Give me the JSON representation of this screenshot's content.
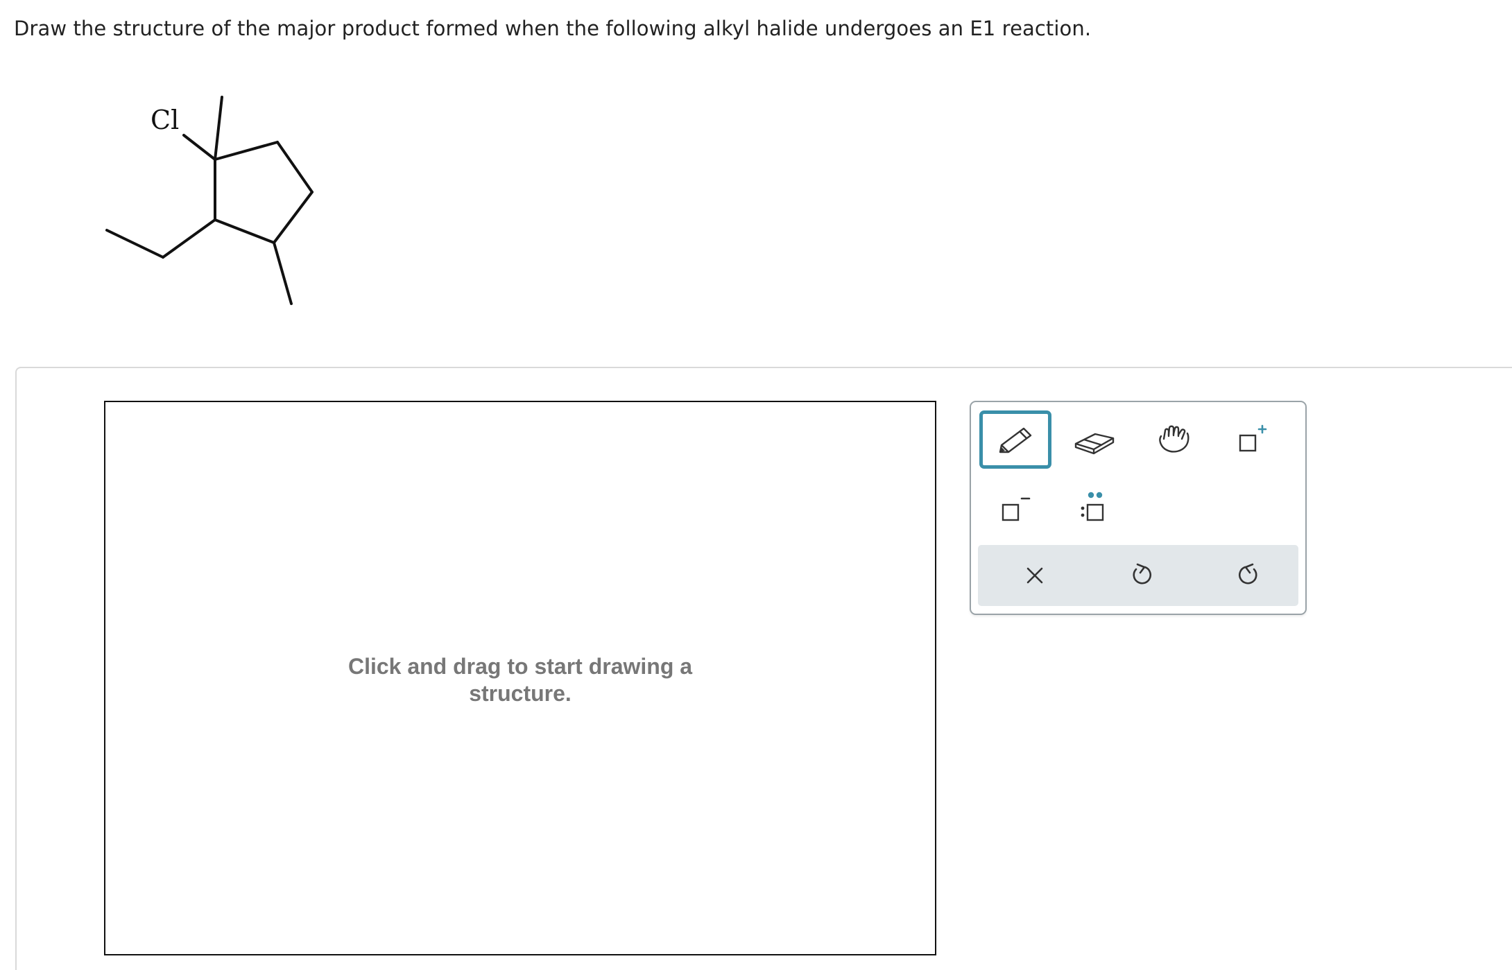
{
  "question": {
    "text": "Draw the structure of the major product formed when the following alkyl halide undergoes an E1 reaction."
  },
  "molecule": {
    "halogen_label": "Cl"
  },
  "canvas": {
    "hint_line1": "Click and drag to start drawing a",
    "hint_line2": "structure."
  },
  "toolbar": {
    "accent_color": "#3a8fa9",
    "tools": [
      {
        "name": "pencil",
        "icon": "pencil-icon",
        "selected": true
      },
      {
        "name": "eraser",
        "icon": "eraser-icon",
        "selected": false
      },
      {
        "name": "move",
        "icon": "hand-icon",
        "selected": false
      },
      {
        "name": "positive-charge",
        "icon": "box-plus-icon",
        "selected": false
      },
      {
        "name": "negative-charge",
        "icon": "box-minus-icon",
        "selected": false
      },
      {
        "name": "lone-pair",
        "icon": "box-lone-pair-icon",
        "selected": false
      }
    ],
    "actions": [
      {
        "name": "clear",
        "icon": "close-icon"
      },
      {
        "name": "undo",
        "icon": "undo-icon"
      },
      {
        "name": "redo",
        "icon": "redo-icon"
      }
    ]
  }
}
